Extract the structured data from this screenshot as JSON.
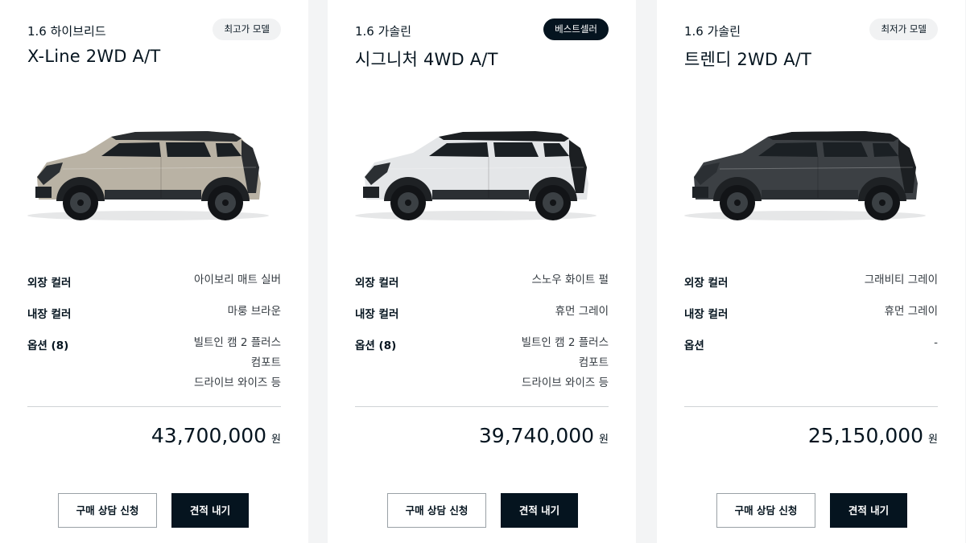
{
  "cards": [
    {
      "powertrain": "1.6 하이브리드",
      "trim": "X-Line 2WD A/T",
      "badge": "최고가 모델",
      "body_color": "#b9b2a4",
      "roof_color": "#2a2d30",
      "specs": {
        "exterior": {
          "label": "외장 컬러",
          "value": "아이보리 매트 실버"
        },
        "interior": {
          "label": "내장 컬러",
          "value": "마룽 브라운"
        },
        "options": {
          "label": "옵션 (8)",
          "lines": [
            "빌트인 캠 2 플러스",
            "컴포트",
            "드라이브 와이즈 등"
          ]
        }
      },
      "price": "43,700,000",
      "currency": "원",
      "consult_label": "구매 상담 신청",
      "quote_label": "견적 내기"
    },
    {
      "powertrain": "1.6 가솔린",
      "trim": "시그니처 4WD A/T",
      "badge": "베스트셀러",
      "body_color": "#e4e6e8",
      "roof_color": "#1c1f22",
      "specs": {
        "exterior": {
          "label": "외장 컬러",
          "value": "스노우 화이트 펄"
        },
        "interior": {
          "label": "내장 컬러",
          "value": "휴먼 그레이"
        },
        "options": {
          "label": "옵션 (8)",
          "lines": [
            "빌트인 캠 2 플러스",
            "컴포트",
            "드라이브 와이즈 등"
          ]
        }
      },
      "price": "39,740,000",
      "currency": "원",
      "consult_label": "구매 상담 신청",
      "quote_label": "견적 내기"
    },
    {
      "powertrain": "1.6 가솔린",
      "trim": "트렌디 2WD A/T",
      "badge": "최저가 모델",
      "body_color": "#3c4044",
      "roof_color": "#1c1f22",
      "specs": {
        "exterior": {
          "label": "외장 컬러",
          "value": "그래비티 그레이"
        },
        "interior": {
          "label": "내장 컬러",
          "value": "휴먼 그레이"
        },
        "options": {
          "label": "옵션",
          "lines": [
            "-"
          ]
        }
      },
      "price": "25,150,000",
      "currency": "원",
      "consult_label": "구매 상담 신청",
      "quote_label": "견적 내기"
    }
  ]
}
